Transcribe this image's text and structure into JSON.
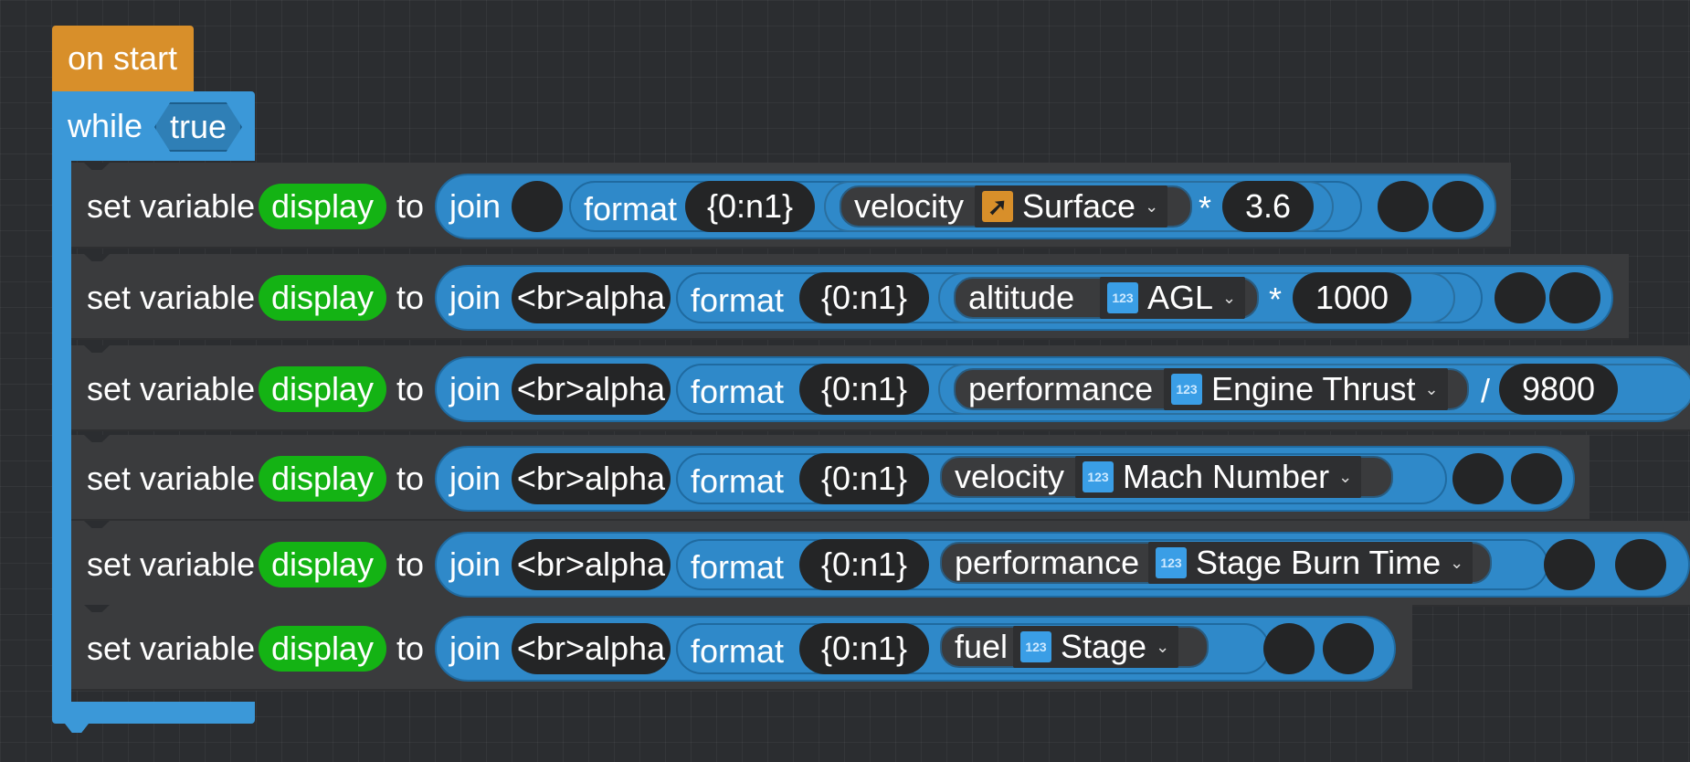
{
  "event": {
    "label": "on start"
  },
  "loop": {
    "keyword": "while",
    "condition": "true"
  },
  "common": {
    "set_variable": "set variable",
    "variable": "display",
    "to": "to",
    "join": "join",
    "format": "format"
  },
  "rows": [
    {
      "prefix": "",
      "format_spec": "{0:n1}",
      "category": "velocity",
      "property": "Surface",
      "property_icon": "arrow-icon",
      "operator": "*",
      "operand": "3.6"
    },
    {
      "prefix": "<br>alpha",
      "format_spec": "{0:n1}",
      "category": "altitude",
      "property": "AGL",
      "property_icon": "number-icon",
      "operator": "*",
      "operand": "1000"
    },
    {
      "prefix": "<br>alpha",
      "format_spec": "{0:n1}",
      "category": "performance",
      "property": "Engine Thrust",
      "property_icon": "number-icon",
      "operator": "/",
      "operand": "9800"
    },
    {
      "prefix": "<br>alpha",
      "format_spec": "{0:n1}",
      "category": "velocity",
      "property": "Mach Number",
      "property_icon": "number-icon",
      "operator": "",
      "operand": ""
    },
    {
      "prefix": "<br>alpha",
      "format_spec": "{0:n1}",
      "category": "performance",
      "property": "Stage Burn Time",
      "property_icon": "number-icon",
      "operator": "",
      "operand": ""
    },
    {
      "prefix": "<br>alpha",
      "format_spec": "{0:n1}",
      "category": "fuel",
      "property": "Stage",
      "property_icon": "number-icon",
      "operator": "",
      "operand": ""
    }
  ],
  "icons": {
    "number_glyph": "123",
    "arrow_glyph": "➚",
    "dropdown_glyph": "⌄"
  },
  "colors": {
    "event": "#d88f2a",
    "loop": "#3b98d8",
    "variable": "#14b314",
    "expression": "#2f89c9",
    "background": "#2b2d30"
  }
}
